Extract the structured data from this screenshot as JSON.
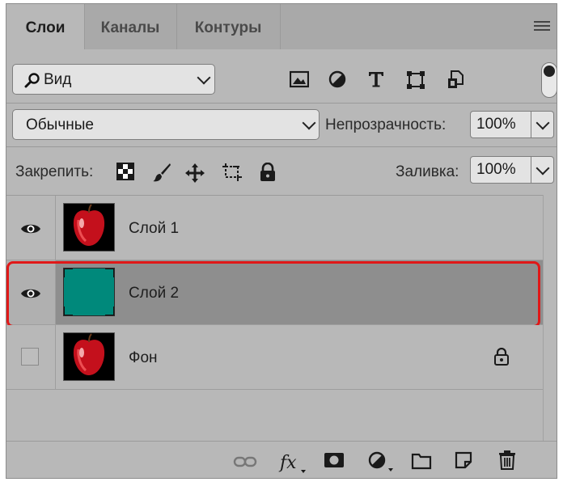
{
  "tabs": [
    {
      "label": "Слои",
      "active": true
    },
    {
      "label": "Каналы",
      "active": false
    },
    {
      "label": "Контуры",
      "active": false
    }
  ],
  "filter": {
    "kind_label": "Вид",
    "icons": [
      "image-filter-icon",
      "adjustment-filter-icon",
      "text-filter-icon",
      "shape-filter-icon",
      "smart-object-filter-icon"
    ]
  },
  "blend": {
    "mode": "Обычные",
    "opacity_label": "Непрозрачность:",
    "opacity_value": "100%"
  },
  "locks": {
    "label": "Закрепить:",
    "fill_label": "Заливка:",
    "fill_value": "100%"
  },
  "layers": [
    {
      "name": "Слой 1",
      "visible": true,
      "thumb": "red-apple",
      "locked": false,
      "selected": false
    },
    {
      "name": "Слой 2",
      "visible": true,
      "thumb": "teal-fill",
      "thumb_color": "#00897b",
      "locked": false,
      "selected": true
    },
    {
      "name": "Фон",
      "visible": false,
      "thumb": "red-apple",
      "locked": true,
      "selected": false
    }
  ],
  "colors": {
    "highlight": "#e01818",
    "teal": "#00897b",
    "panel": "#b8b8b8",
    "selected_row": "#8e8e8e"
  }
}
